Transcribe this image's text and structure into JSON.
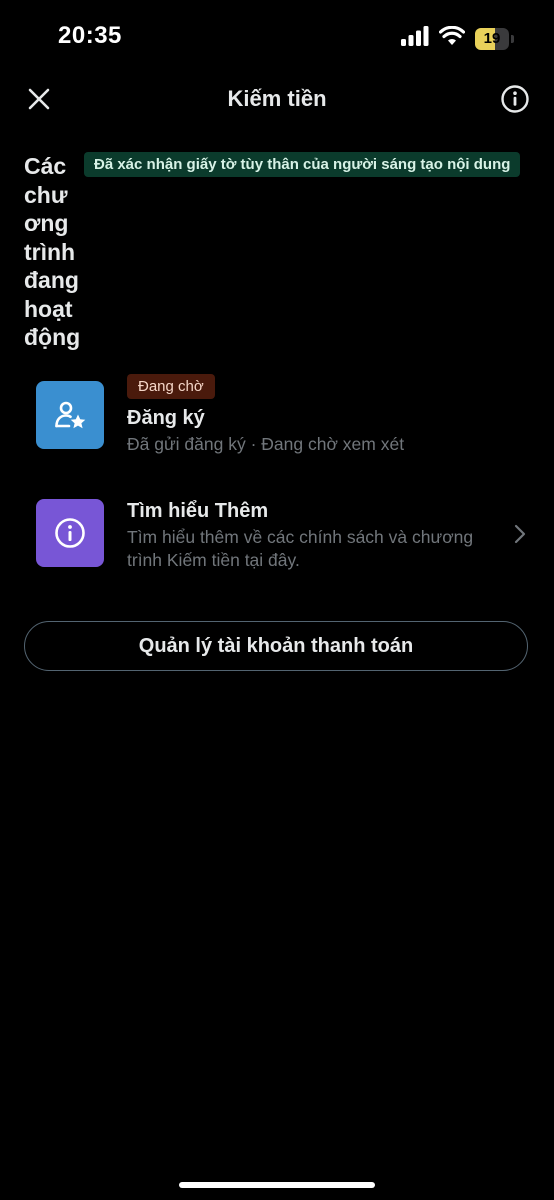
{
  "status_bar": {
    "time": "20:35",
    "battery_level": "19",
    "battery_fraction": 0.6
  },
  "header": {
    "title": "Kiếm tiền"
  },
  "section": {
    "title": "Các chương trình đang hoạt động",
    "verified_badge": "Đã xác nhận giấy tờ tùy thân của người sáng tạo nội dung"
  },
  "programs": [
    {
      "badge": "Đang chờ",
      "title": "Đăng ký",
      "description": "Đã gửi đăng ký · Đang chờ xem xét",
      "icon": "subscription-star-person-icon",
      "color": "#3a8fd0"
    },
    {
      "title": "Tìm hiểu Thêm",
      "description": "Tìm hiểu thêm về các chính sách và chương trình Kiếm tiền tại đây.",
      "icon": "info-circle-icon",
      "color": "#7856d6"
    }
  ],
  "payment_button": {
    "label": "Quản lý tài khoản thanh toán"
  },
  "colors": {
    "background": "#000000",
    "verified_badge_bg": "#0b3b2c",
    "pending_badge_bg": "#4a1a0c",
    "secondary_text": "#71767b"
  }
}
